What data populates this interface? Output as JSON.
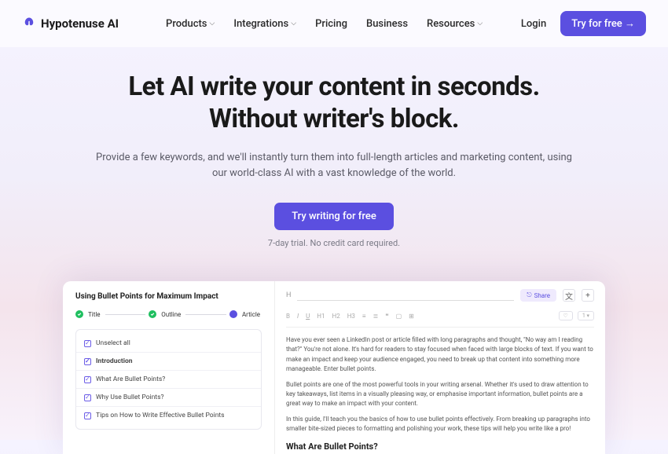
{
  "brand": "Hypotenuse AI",
  "nav": {
    "items": [
      {
        "label": "Products",
        "dropdown": true
      },
      {
        "label": "Integrations",
        "dropdown": true
      },
      {
        "label": "Pricing",
        "dropdown": false
      },
      {
        "label": "Business",
        "dropdown": false
      },
      {
        "label": "Resources",
        "dropdown": true
      }
    ],
    "login": "Login",
    "cta": "Try for free →"
  },
  "hero": {
    "title_line1": "Let AI write your content in seconds.",
    "title_line2": "Without writer's block.",
    "subtitle": "Provide a few keywords, and we'll instantly turn them into full-length articles and marketing content, using our world-class AI with a vast knowledge of the world.",
    "cta": "Try writing for free",
    "trial_note": "7-day trial. No credit card required."
  },
  "preview": {
    "title": "Using Bullet Points for Maximum Impact",
    "steps": [
      {
        "label": "Title",
        "state": "done"
      },
      {
        "label": "Outline",
        "state": "done"
      },
      {
        "label": "Article",
        "state": "active"
      }
    ],
    "outline": {
      "unselect": "Unselect all",
      "items": [
        {
          "label": "Introduction",
          "bold": true
        },
        {
          "label": "What Are Bullet Points?"
        },
        {
          "label": "Why Use Bullet Points?"
        },
        {
          "label": "Tips on How to Write Effective Bullet Points"
        }
      ]
    },
    "editor": {
      "h_prefix": "H",
      "share": "Share",
      "paragraphs": [
        "Have you ever seen a LinkedIn post or article filled with long paragraphs and thought, \"No way am I reading that?\" You're not alone. It's hard for readers to stay focused when faced with large blocks of text. If you want to make an impact and keep your audience engaged, you need to break up that content into something more manageable. Enter bullet points.",
        "Bullet points are one of the most powerful tools in your writing arsenal. Whether it's used to draw attention to key takeaways, list items in a visually pleasing way, or emphasise important information, bullet points are a great way to make an impact with your content.",
        "In this guide, I'll teach you the basics of how to use bullet points effectively. From breaking up paragraphs into smaller bite-sized pieces to formatting and polishing your work, these tips will help you write like a pro!"
      ],
      "heading": "What Are Bullet Points?"
    }
  }
}
